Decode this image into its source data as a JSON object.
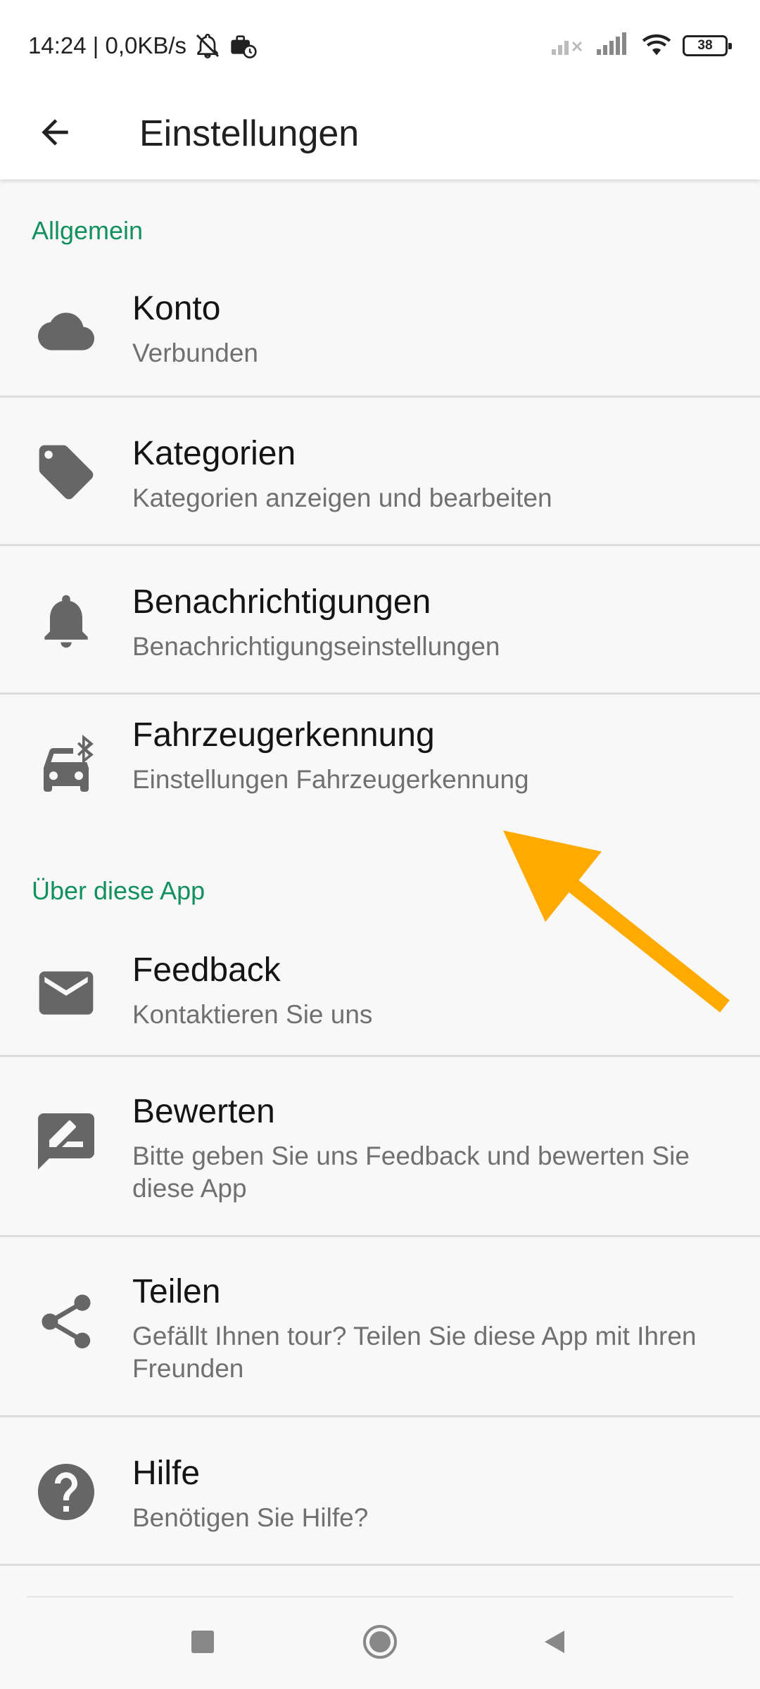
{
  "status_bar": {
    "time_speed": "14:24 | 0,0KB/s",
    "battery_level": "38",
    "icons": [
      "notifications-off-icon",
      "briefcase-clock-icon",
      "signal-off-icon",
      "signal-icon",
      "wifi-icon",
      "battery-icon"
    ]
  },
  "app_bar": {
    "title": "Einstellungen",
    "back_icon": "arrow-back-icon"
  },
  "sections": [
    {
      "header": "Allgemein",
      "items": [
        {
          "title": "Konto",
          "subtitle": "Verbunden",
          "icon": "cloud-icon"
        },
        {
          "title": "Kategorien",
          "subtitle": "Kategorien anzeigen und bearbeiten",
          "icon": "tag-icon"
        },
        {
          "title": "Benachrichtigungen",
          "subtitle": "Benachrichtigungseinstellungen",
          "icon": "bell-icon"
        },
        {
          "title": "Fahrzeugerkennung",
          "subtitle": "Einstellungen Fahrzeugerkennung",
          "icon": "car-bluetooth-icon"
        }
      ]
    },
    {
      "header": "Über diese App",
      "items": [
        {
          "title": "Feedback",
          "subtitle": "Kontaktieren Sie uns",
          "icon": "mail-icon"
        },
        {
          "title": "Bewerten",
          "subtitle": "Bitte geben Sie uns Feedback und bewerten Sie diese App",
          "icon": "rate-review-icon"
        },
        {
          "title": "Teilen",
          "subtitle": "Gefällt Ihnen tour? Teilen Sie diese App mit Ihren Freunden",
          "icon": "share-icon"
        },
        {
          "title": "Hilfe",
          "subtitle": "Benötigen Sie Hilfe?",
          "icon": "help-icon"
        }
      ]
    }
  ],
  "nav_bar": {
    "icons": [
      "recents-square-icon",
      "home-circle-icon",
      "back-triangle-icon"
    ]
  },
  "colors": {
    "section_header": "#129060",
    "icon_gray": "#666666",
    "annotation_arrow": "#FFAA00"
  }
}
